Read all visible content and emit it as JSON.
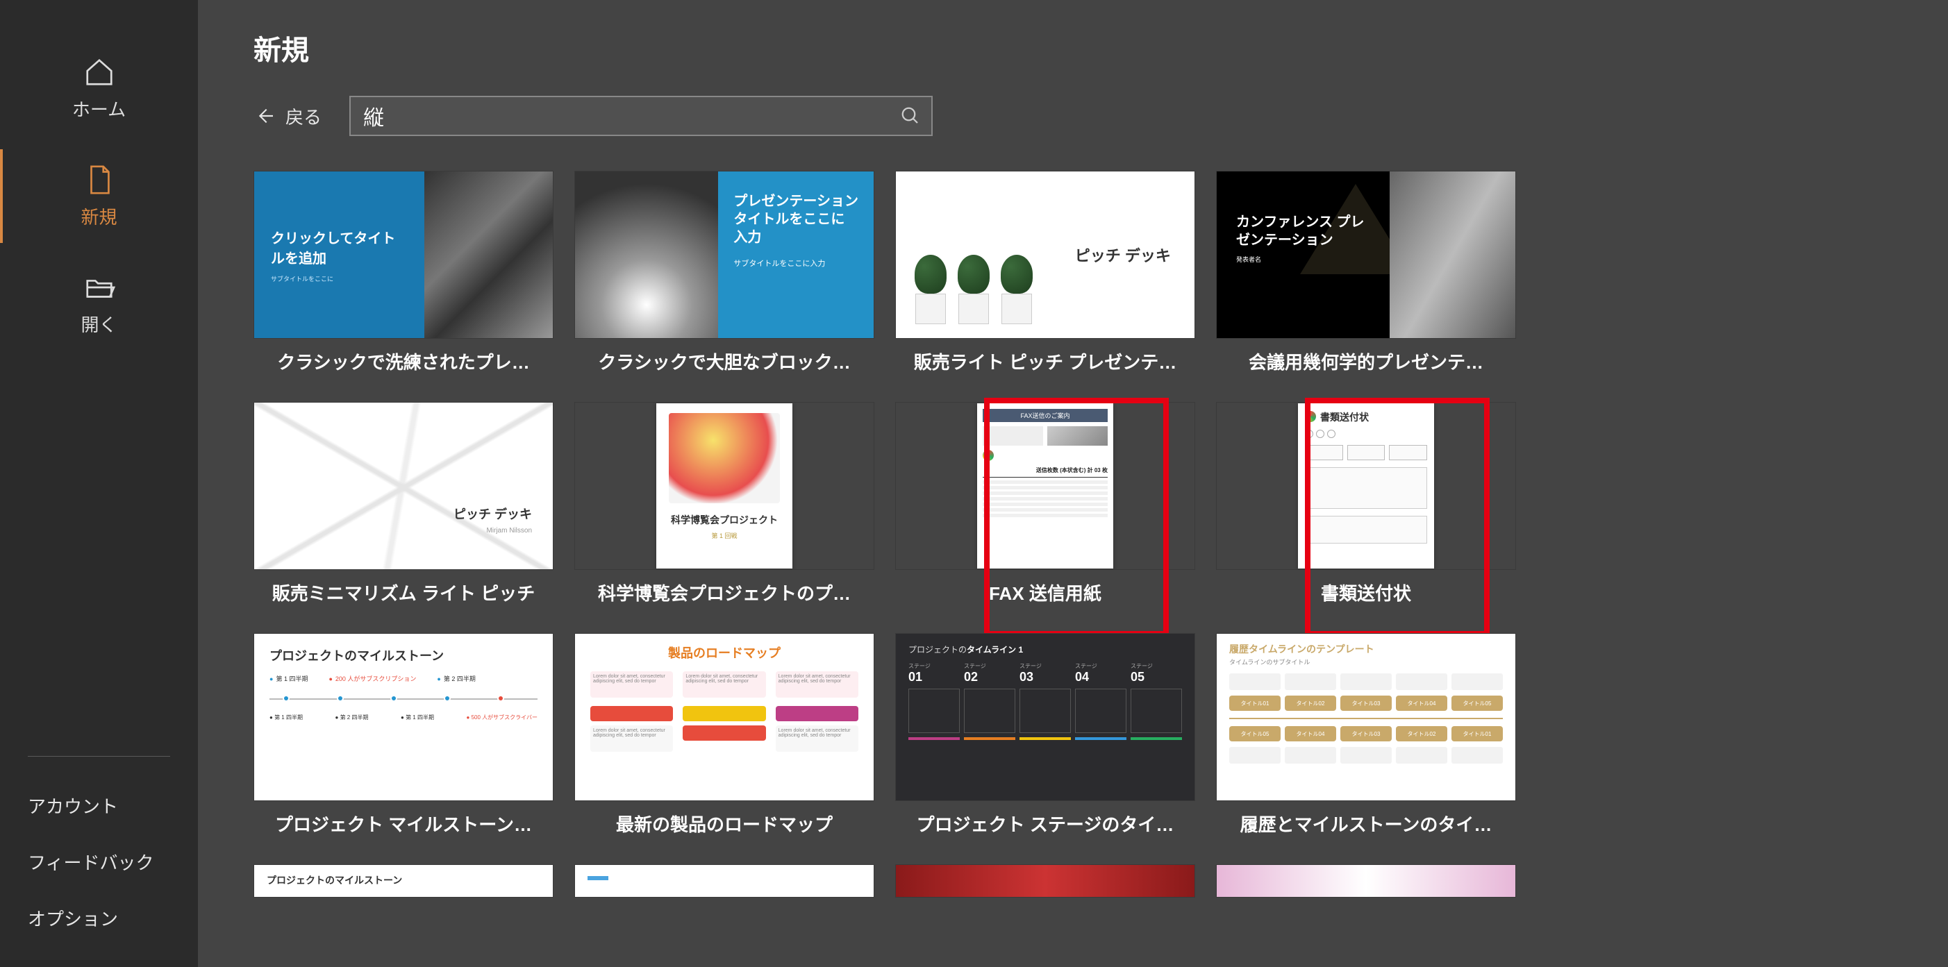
{
  "sidebar": {
    "items": [
      {
        "id": "home",
        "label": "ホーム"
      },
      {
        "id": "new",
        "label": "新規"
      },
      {
        "id": "open",
        "label": "開く"
      }
    ],
    "bottom": [
      {
        "id": "account",
        "label": "アカウント"
      },
      {
        "id": "feedback",
        "label": "フィードバック"
      },
      {
        "id": "options",
        "label": "オプション"
      }
    ]
  },
  "page": {
    "title": "新規",
    "back_label": "戻る"
  },
  "search": {
    "value": "縦"
  },
  "templates": {
    "row1": [
      {
        "label": "クラシックで洗練されたプレ…",
        "thumb": {
          "title": "クリックしてタイトルを追加",
          "sub": "サブタイトルをここに"
        }
      },
      {
        "label": "クラシックで大胆なブロック…",
        "thumb": {
          "title": "プレゼンテーション タイトルをここに入力",
          "sub": "サブタイトルをここに入力"
        }
      },
      {
        "label": "販売ライト ピッチ プレゼンテ…",
        "thumb": {
          "title": "ピッチ デッキ"
        }
      },
      {
        "label": "会議用幾何学的プレゼンテ…",
        "thumb": {
          "title": "カンファレンス プレゼンテーション",
          "sub": "発表者名"
        }
      }
    ],
    "row2": [
      {
        "label": "販売ミニマリズム ライト ピッチ",
        "thumb": {
          "title": "ピッチ デッキ",
          "sub": "Mirjam  Nilsson"
        }
      },
      {
        "label": "科学博覧会プロジェクトのプ…",
        "thumb": {
          "title": "科学博覧会プロジェクト",
          "sub": "第 1 回戦"
        }
      },
      {
        "label": "FAX 送信用紙",
        "highlighted": true,
        "thumb": {
          "header": "FAX送信のご案内",
          "total_label": "送信枚数 (本状含む) 計",
          "total_value": "03",
          "unit": "枚"
        }
      },
      {
        "label": "書類送付状",
        "highlighted": true,
        "thumb": {
          "title": "書類送付状"
        }
      }
    ],
    "row3": [
      {
        "label": "プロジェクト マイルストーン…",
        "thumb": {
          "title": "プロジェクトのマイルストーン",
          "legend1": "第 1 四半期",
          "legend2": "第 2 四半期",
          "note1": "200 人がサブスクリプション",
          "note2": "500 人がサブスクライバー"
        }
      },
      {
        "label": "最新の製品のロードマップ",
        "thumb": {
          "title": "製品のロードマップ",
          "cell_text": "Lorem dolor sit amet, consectetur adipiscing elit, sed do tempor"
        }
      },
      {
        "label": "プロジェクト ステージのタイ…",
        "thumb": {
          "title_prefix": "プロジェクトの",
          "title_bold": "タイムライン 1",
          "stages": [
            "01",
            "02",
            "03",
            "04",
            "05"
          ],
          "stage_label": "ステージ"
        }
      },
      {
        "label": "履歴とマイルストーンのタイ…",
        "thumb": {
          "title_prefix": "履歴タイムラインの",
          "title_accent": "テンプレート",
          "sub": "タイムラインのサブタイトル",
          "chip": "タイトル"
        }
      }
    ],
    "row4": [
      {
        "label": "",
        "thumb": {
          "title": "プロジェクトのマイルストーン"
        }
      },
      {
        "label": ""
      },
      {
        "label": ""
      },
      {
        "label": ""
      }
    ]
  }
}
